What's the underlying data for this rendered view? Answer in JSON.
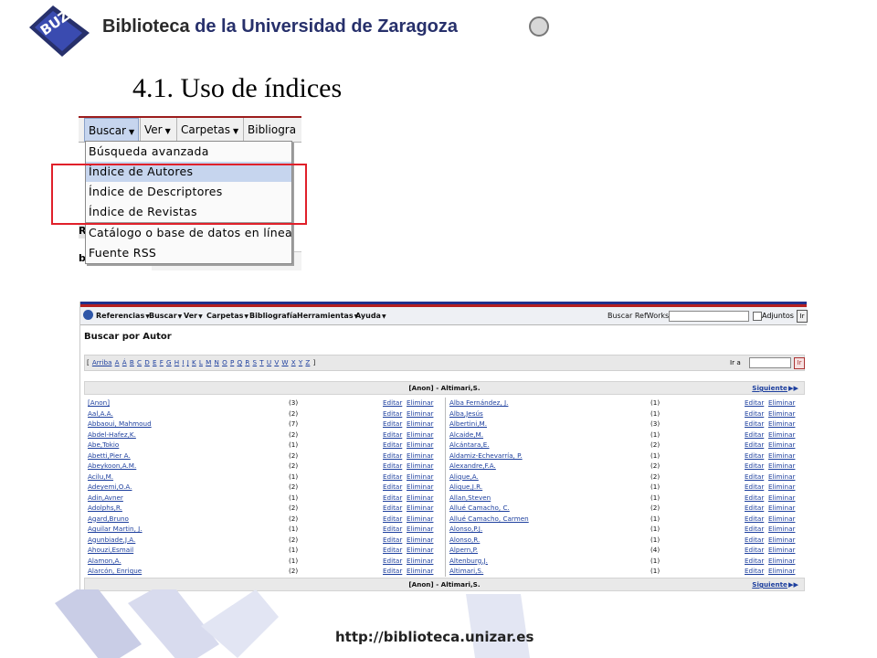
{
  "header": {
    "logo_text": "BUZ",
    "brand_part1": "Biblioteca ",
    "brand_part2": "de la Universidad de Zaragoza"
  },
  "slide_title": "4.1. Uso de índices",
  "menu_shot": {
    "menubar": [
      "Buscar",
      "Ver",
      "Carpetas",
      "Bibliogra"
    ],
    "dropdown": [
      {
        "label": "Búsqueda avanzada",
        "highlighted": false
      },
      {
        "label": "Índice de Autores",
        "highlighted": true
      },
      {
        "label": "Índice de Descriptores",
        "highlighted": false
      },
      {
        "label": "Índice de Revistas",
        "highlighted": false
      },
      {
        "label": "Catálogo o base de datos en línea",
        "highlighted": false
      },
      {
        "label": "Fuente RSS",
        "highlighted": false
      }
    ],
    "bg_letters": [
      "R",
      "b"
    ]
  },
  "refworks": {
    "toolbar": [
      "Referencias",
      "Buscar",
      "Ver",
      "Carpetas",
      "Bibliografía",
      "Herramientas",
      "Ayuda"
    ],
    "search_label": "Buscar RefWorks",
    "attach_label": "Adjuntos",
    "go_label": "Ir",
    "heading": "Buscar por Autor",
    "alpha_open": "[",
    "alpha_close": "]",
    "alpha_links": [
      "Arriba",
      "A",
      "Á",
      "B",
      "C",
      "D",
      "E",
      "F",
      "G",
      "H",
      "I",
      "J",
      "K",
      "L",
      "M",
      "N",
      "O",
      "P",
      "Q",
      "R",
      "S",
      "T",
      "U",
      "V",
      "W",
      "X",
      "Y",
      "Z"
    ],
    "goto_label": "Ir a",
    "goto_btn": "Ir",
    "range_text": "[Anon] - Altimari,S.",
    "next_label": "Siguiente",
    "edit_label": "Editar",
    "delete_label": "Eliminar",
    "left_authors": [
      {
        "name": "[Anon]",
        "count": "(3)"
      },
      {
        "name": "Aal,A.A.",
        "count": "(2)"
      },
      {
        "name": "Abbaoui, Mahmoud",
        "count": "(7)"
      },
      {
        "name": "Abdel-Hafez,K.",
        "count": "(2)"
      },
      {
        "name": "Abe,Tokio",
        "count": "(1)"
      },
      {
        "name": "Abetti,Pier A.",
        "count": "(2)"
      },
      {
        "name": "Abeykoon,A.M.",
        "count": "(2)"
      },
      {
        "name": "Acilu,M.",
        "count": "(1)"
      },
      {
        "name": "Adeyemi,O.A.",
        "count": "(2)"
      },
      {
        "name": "Adin,Avner",
        "count": "(1)"
      },
      {
        "name": "Adolphs,R.",
        "count": "(2)"
      },
      {
        "name": "Agard,Bruno",
        "count": "(2)"
      },
      {
        "name": "Aguilar Martin, J.",
        "count": "(1)"
      },
      {
        "name": "Agunbiade,J.A.",
        "count": "(2)"
      },
      {
        "name": "Ahouzi,Esmail",
        "count": "(1)"
      },
      {
        "name": "Alamon,A.",
        "count": "(1)"
      },
      {
        "name": "Alarcón, Enrique",
        "count": "(2)"
      }
    ],
    "right_authors": [
      {
        "name": "Alba Fernández, J.",
        "count": "(1)"
      },
      {
        "name": "Alba,Jesús",
        "count": "(1)"
      },
      {
        "name": "Albertini,M.",
        "count": "(3)"
      },
      {
        "name": "Alcaide,M.",
        "count": "(1)"
      },
      {
        "name": "Alcántara,E.",
        "count": "(2)"
      },
      {
        "name": "Aldamiz-Echevarría, P.",
        "count": "(1)"
      },
      {
        "name": "Alexandre,F.A.",
        "count": "(2)"
      },
      {
        "name": "Alique,A.",
        "count": "(2)"
      },
      {
        "name": "Alique,J.R.",
        "count": "(1)"
      },
      {
        "name": "Allan,Steven",
        "count": "(1)"
      },
      {
        "name": "Allué Camacho, C.",
        "count": "(2)"
      },
      {
        "name": "Allué Camacho, Carmen",
        "count": "(1)"
      },
      {
        "name": "Alonso,P.J.",
        "count": "(1)"
      },
      {
        "name": "Alonso,R.",
        "count": "(1)"
      },
      {
        "name": "Alpern,P.",
        "count": "(4)"
      },
      {
        "name": "Altenburg,J.",
        "count": "(1)"
      },
      {
        "name": "Altimari,S.",
        "count": "(1)"
      }
    ]
  },
  "footer": {
    "url": "http://biblioteca.unizar.es"
  }
}
